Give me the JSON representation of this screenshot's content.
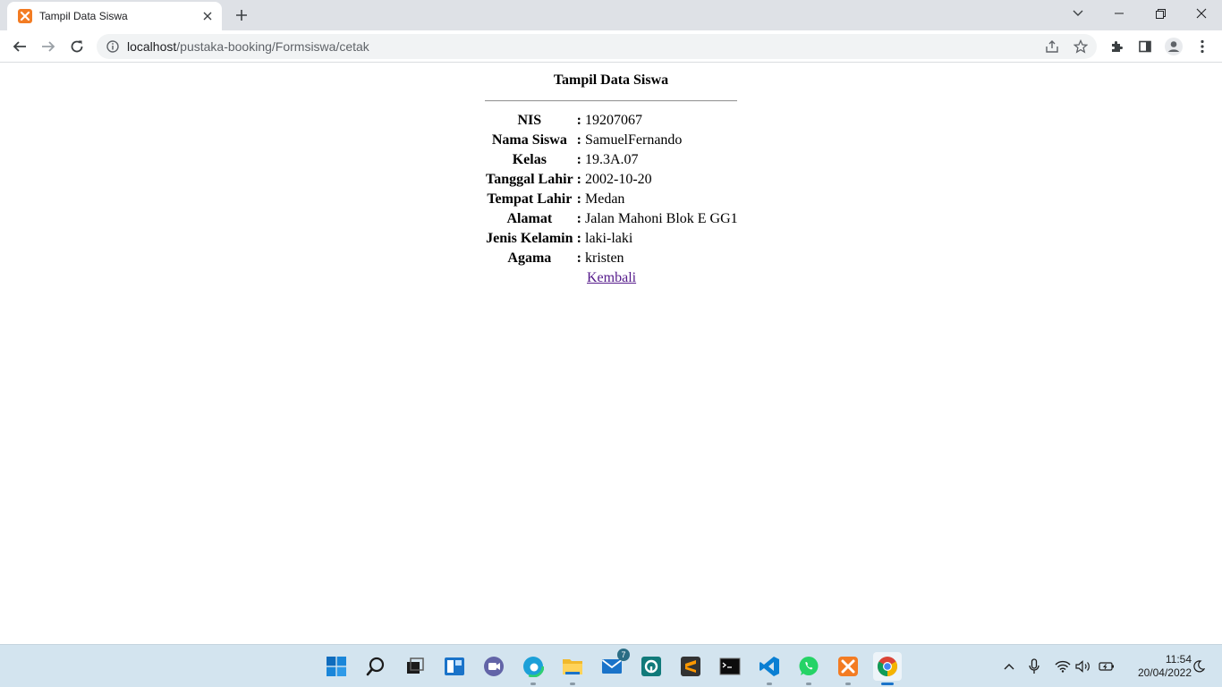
{
  "browser": {
    "tab_title": "Tampil Data Siswa",
    "url_host": "localhost",
    "url_path": "/pustaka-booking/Formsiswa/cetak"
  },
  "page": {
    "title": "Tampil Data Siswa",
    "separator": ":",
    "rows": [
      {
        "label": "NIS",
        "value": "19207067"
      },
      {
        "label": "Nama Siswa",
        "value": "SamuelFernando"
      },
      {
        "label": "Kelas",
        "value": "19.3A.07"
      },
      {
        "label": "Tanggal Lahir",
        "value": "2002-10-20"
      },
      {
        "label": "Tempat Lahir",
        "value": "Medan"
      },
      {
        "label": "Alamat",
        "value": "Jalan Mahoni Blok E GG1"
      },
      {
        "label": "Jenis Kelamin",
        "value": "laki-laki"
      },
      {
        "label": "Agama",
        "value": "kristen"
      }
    ],
    "back_link": "Kembali"
  },
  "taskbar": {
    "mail_badge": "7",
    "time": "11:54",
    "date": "20/04/2022"
  },
  "colors": {
    "accent": "#1a73c9",
    "link_visited": "#551a8b",
    "xampp_orange": "#f37c23"
  }
}
